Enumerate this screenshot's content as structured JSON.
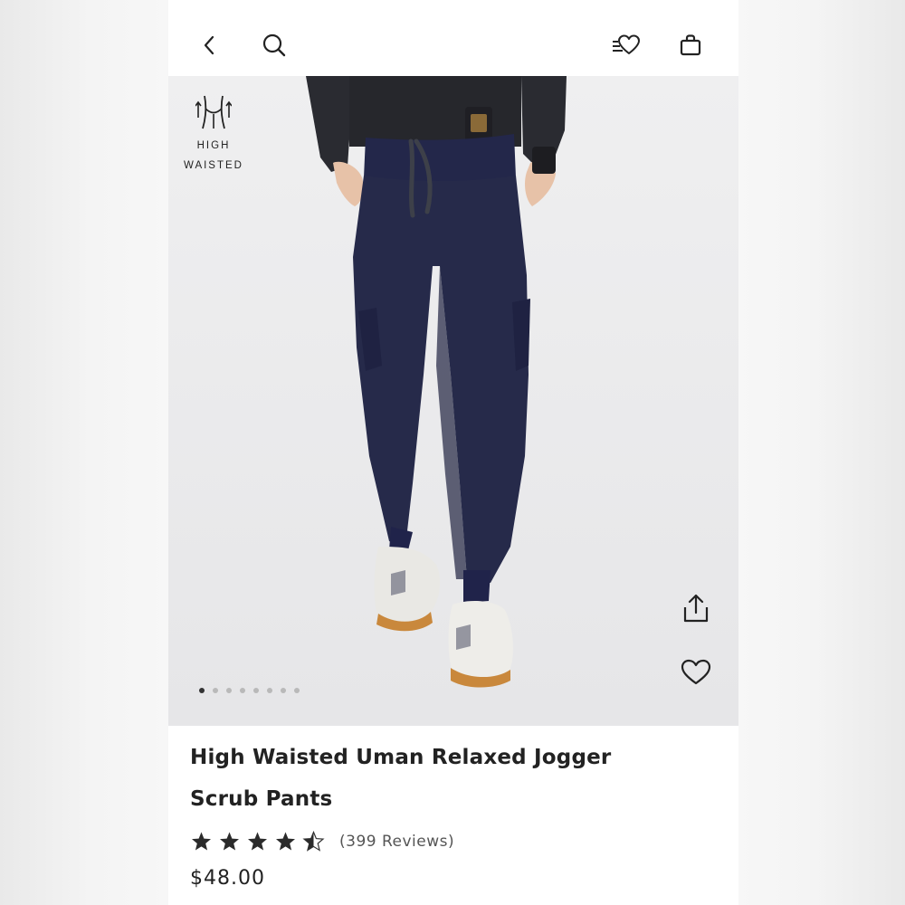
{
  "header": {
    "back_icon": "chevron-left-icon",
    "search_icon": "search-icon",
    "wishlist_icon": "heart-list-icon",
    "bag_icon": "shopping-bag-icon"
  },
  "badge": {
    "icon": "high-waist-icon",
    "line1": "HIGH",
    "line2": "WAISTED"
  },
  "gallery": {
    "image_count": 8,
    "active_index": 0,
    "share_icon": "share-icon",
    "favorite_icon": "heart-icon"
  },
  "product": {
    "title_line1": "High Waisted Uman Relaxed Jogger",
    "title_line2": "Scrub Pants",
    "rating": 4.5,
    "rating_max": 5,
    "reviews_text": "(399 Reviews)",
    "price": "$48.00"
  },
  "colors": {
    "pants": "#262a4a",
    "background": "#eeeeef",
    "text": "#222222"
  }
}
